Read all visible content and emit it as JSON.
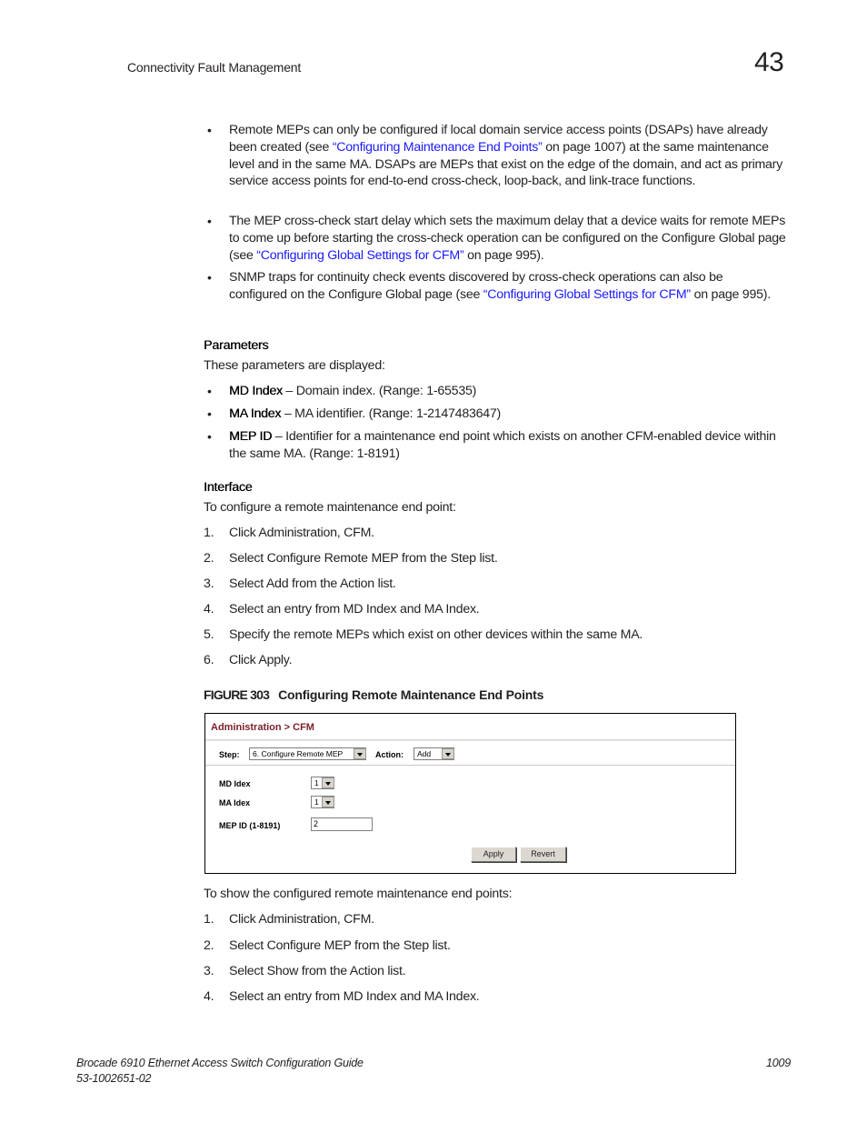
{
  "header": {
    "section_title": "Connectivity Fault Management",
    "chapter_number": "43"
  },
  "intro_bullets": [
    {
      "parts": [
        {
          "text": "Remote MEPs can only be configured if local domain service access points (DSAPs) have already been created (see "
        },
        {
          "text": "“Configuring Maintenance End Points”",
          "link": true
        },
        {
          "text": " on page 1007) at the same maintenance level and in the same MA. DSAPs are MEPs that exist on the edge of the domain, and act as primary service access points for end-to-end cross-check, loop-back, and link-trace functions."
        }
      ]
    },
    {
      "parts": [
        {
          "text": "The MEP cross-check start delay which sets the maximum delay that a device waits for remote MEPs to come up before starting the cross-check operation can be configured on the Configure Global page (see "
        },
        {
          "text": "“Configuring Global Settings for CFM”",
          "link": true
        },
        {
          "text": " on page 995)."
        }
      ]
    },
    {
      "parts": [
        {
          "text": "SNMP traps for continuity check events discovered by cross-check operations can also be configured on the Configure Global page (see "
        },
        {
          "text": "“Configuring Global Settings for CFM”",
          "link": true
        },
        {
          "text": " on page 995)."
        }
      ]
    }
  ],
  "parameters": {
    "heading": "Parameters",
    "intro": "These parameters are displayed:",
    "items": [
      {
        "term": "MD Index",
        "desc": " – Domain index. (Range: 1-65535)"
      },
      {
        "term": "MA Index",
        "desc": " – MA identifier. (Range: 1-2147483647)"
      },
      {
        "term": "MEP ID",
        "desc": " – Identifier for a maintenance end point which exists on another CFM-enabled device within the same MA. (Range: 1-8191)"
      }
    ]
  },
  "interface": {
    "heading": "Interface",
    "intro": "To configure a remote maintenance end point:",
    "steps": [
      {
        "num": "1.",
        "text": "Click Administration, CFM."
      },
      {
        "num": "2.",
        "text": "Select Configure Remote MEP from the Step list."
      },
      {
        "num": "3.",
        "text": "Select Add from the Action list."
      },
      {
        "num": "4.",
        "text": "Select an entry from MD Index and MA Index."
      },
      {
        "num": "5.",
        "text": "Specify the remote MEPs which exist on other devices within the same MA."
      },
      {
        "num": "6.",
        "text": "Click Apply."
      }
    ]
  },
  "figure": {
    "label": "FIGURE 303",
    "title": "Configuring Remote Maintenance End Points",
    "ui": {
      "breadcrumb": "Administration > CFM",
      "step_label": "Step:",
      "step_value": "6. Configure Remote MEP",
      "action_label": "Action:",
      "action_value": "Add",
      "md_index_label": "MD Idex",
      "md_index_value": "1",
      "ma_index_label": "MA Idex",
      "ma_index_value": "1",
      "mep_id_label": "MEP ID (1-8191)",
      "mep_id_value": "2",
      "apply_label": "Apply",
      "revert_label": "Revert",
      "title_color": "#7a1f2a"
    }
  },
  "show": {
    "intro": "To show the configured remote maintenance end points:",
    "steps": [
      {
        "num": "1.",
        "text": "Click Administration, CFM."
      },
      {
        "num": "2.",
        "text": "Select Configure MEP from the Step list."
      },
      {
        "num": "3.",
        "text": "Select Show from the Action list."
      },
      {
        "num": "4.",
        "text": "Select an entry from MD Index and MA Index."
      }
    ]
  },
  "footer": {
    "guide_title": "Brocade 6910 Ethernet Access Switch Configuration Guide",
    "doc_number": "53-1002651-02",
    "page_number": "1009"
  },
  "colors": {
    "link": "#1a1aff",
    "text": "#231f20"
  }
}
